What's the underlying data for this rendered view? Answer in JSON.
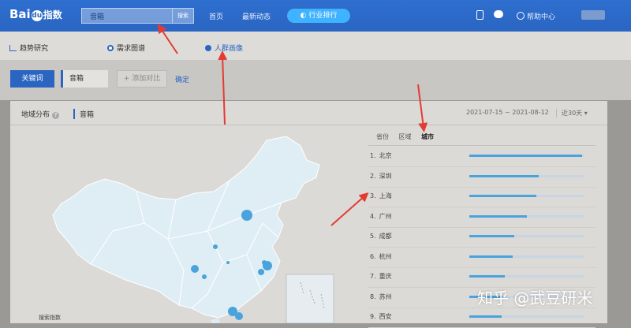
{
  "header": {
    "logo_text": "Bai",
    "logo_paw": "du",
    "logo_cn": "指数",
    "search_value": "音箱",
    "search_button": "搜索",
    "nav": [
      "首页",
      "最新动态"
    ],
    "ranking_button": "行业排行",
    "help": "帮助中心"
  },
  "subnav": {
    "items": [
      "趋势研究",
      "需求图谱",
      "人群画像"
    ],
    "active": "人群画像"
  },
  "keyword_bar": {
    "tab": "关键词",
    "keyword": "音箱",
    "add_compare": "+ 添加对比",
    "confirm": "确定"
  },
  "panel": {
    "title": "地域分布",
    "keyword": "音箱",
    "date_range": "2021-07-15 ~ 2021-08-12",
    "period": "近30天 ▾",
    "map_legend_label": "搜索指数",
    "rank_tabs": [
      "省份",
      "区域",
      "城市"
    ],
    "active_rank_tab": "城市",
    "rankings": [
      {
        "rank": "1.",
        "name": "北京",
        "level": 0.98
      },
      {
        "rank": "2.",
        "name": "深圳",
        "level": 0.6
      },
      {
        "rank": "3.",
        "name": "上海",
        "level": 0.58
      },
      {
        "rank": "4.",
        "name": "广州",
        "level": 0.5
      },
      {
        "rank": "5.",
        "name": "成都",
        "level": 0.39
      },
      {
        "rank": "6.",
        "name": "杭州",
        "level": 0.38
      },
      {
        "rank": "7.",
        "name": "重庆",
        "level": 0.31
      },
      {
        "rank": "8.",
        "name": "苏州",
        "level": 0.29
      },
      {
        "rank": "9.",
        "name": "西安",
        "level": 0.28
      }
    ]
  },
  "colors": {
    "brand_blue": "#2a65c2",
    "bar_blue": "#4aa3dc",
    "annotation_red": "#e23b33"
  },
  "watermark": "知乎 @武豆研米"
}
